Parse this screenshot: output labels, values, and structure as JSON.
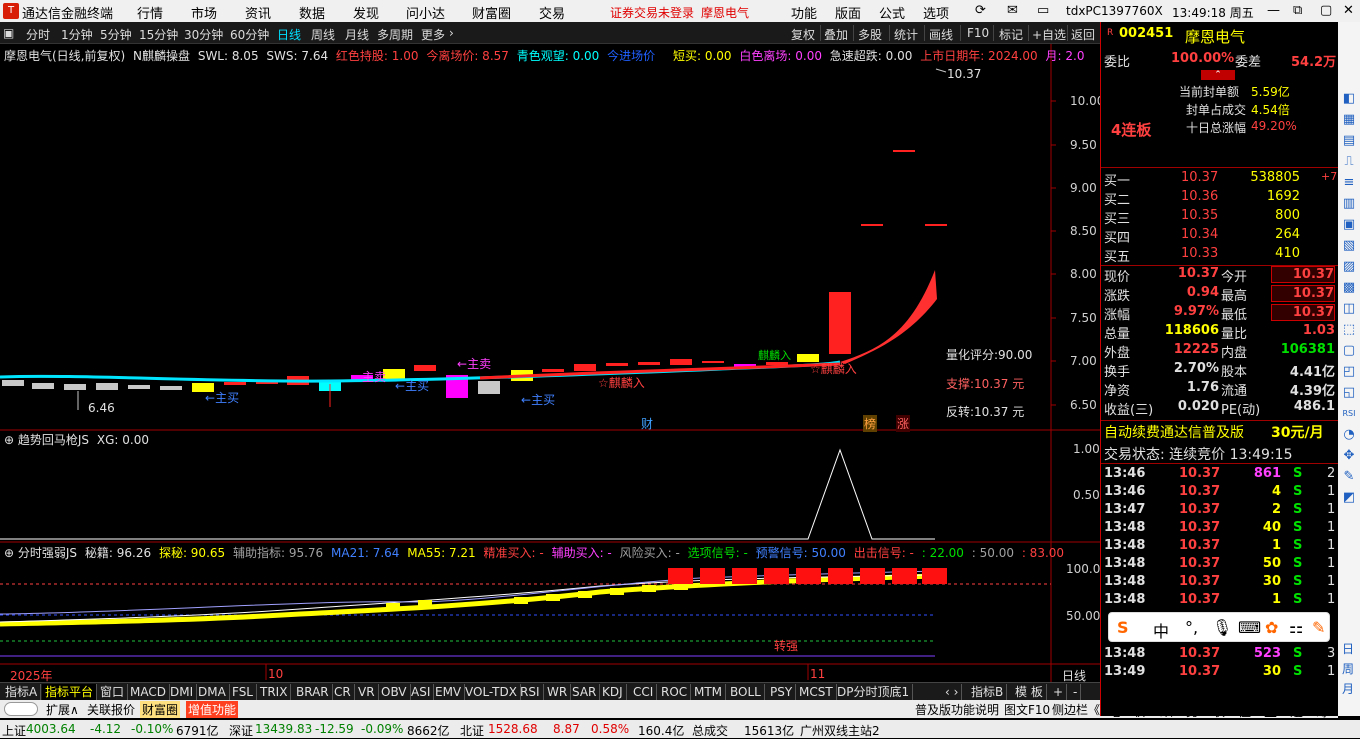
{
  "menubar": {
    "app_title": "通达信金融终端",
    "menus": [
      "行情",
      "市场",
      "资讯",
      "数据",
      "发现",
      "问小达",
      "财富圈",
      "交易"
    ],
    "notice": "证券交易未登录",
    "notice_stock": "摩恩电气",
    "right_menus": [
      "功能",
      "版面",
      "公式",
      "选项"
    ],
    "machine": "tdxPC1397760X",
    "time": "13:49:18 周五"
  },
  "toolbar": {
    "periods": [
      "分时",
      "1分钟",
      "5分钟",
      "15分钟",
      "30分钟",
      "60分钟",
      "日线",
      "周线",
      "月线",
      "多周期",
      "更多"
    ],
    "right": [
      "复权",
      "叠加",
      "多股",
      "统计",
      "画线",
      "F10",
      "标记",
      "+自选",
      "返回"
    ]
  },
  "main_header": {
    "title": "摩恩电气(日线,前复权)",
    "indicator": "N麒麟操盘",
    "swl": "SWL: 8.05",
    "sws": "SWS: 7.64",
    "red_hold": "红色持股: 1.00",
    "today_exit": "今离场价: 8.57",
    "cyan_watch": "青色观望: 0.00",
    "today_entry": "今进场价",
    "short_buy": "短买: 0.00",
    "white_exit": "白色离场: 0.00",
    "fast_drop": "急速超跌: 0.00",
    "list_days": "上市日期年: 2024.00",
    "month": "月: 2.0"
  },
  "main_chart": {
    "price_ticks": [
      "10.00",
      "9.50",
      "9.00",
      "8.50",
      "8.00",
      "7.50",
      "7.00",
      "6.50"
    ],
    "high_label": "10.37",
    "low_label": "6.46",
    "labels": {
      "main_buy_1": "主买",
      "main_buy_2": "主买",
      "main_buy_3": "主买",
      "main_sell_1": "主卖",
      "main_sell_2": "主卖",
      "qilin_1": "麒麟入",
      "qilin_2": "麒麟入",
      "qilin_3": "麒麟入",
      "fin": "财",
      "bang": "榜",
      "zhang": "涨"
    },
    "score": "量化评分:90.00",
    "support": "支撑:10.37 元",
    "reversal": "反转:10.37 元"
  },
  "sub1": {
    "title": "趋势回马枪JS",
    "xg": "XG: 0.00",
    "ticks": [
      "1.00",
      "0.50"
    ]
  },
  "sub2": {
    "title": "分时强弱JS",
    "mj": "秘籍: 96.26",
    "tm": "探秘: 90.65",
    "fz": "辅助指标: 95.76",
    "ma21": "MA21: 7.64",
    "ma55": "MA55: 7.21",
    "jz": "精准买入: -",
    "fzmr": "辅助买入: -",
    "fx": "风险买入: -",
    "xx": "选项信号: -",
    "yj": "预警信号: 50.00",
    "cj": "出击信号: -",
    "v22": ": 22.00",
    "v50": ": 50.00",
    "v83": ": 83.00",
    "ticks": [
      "100.0",
      "50.00"
    ],
    "turn": "转强"
  },
  "xaxis": {
    "year": "2025年",
    "m10": "10",
    "m11": "11",
    "right": "日线"
  },
  "tabs": [
    "指标A",
    "指标平台",
    "窗口",
    "MACD",
    "DMI",
    "DMA",
    "FSL",
    "TRIX",
    "BRAR",
    "CR",
    "VR",
    "OBV",
    "ASI",
    "EMV",
    "VOL-TDX",
    "RSI",
    "WR",
    "SAR",
    "KDJ",
    "CCI",
    "ROC",
    "MTM",
    "BOLL",
    "PSY",
    "MCST",
    "DP分时顶底1",
    "指标B",
    "模 板",
    "+",
    "-"
  ],
  "bottom": {
    "items": [
      "扩展∧",
      "关联报价",
      "财富圈",
      "增值功能"
    ],
    "right": "普及版功能说明",
    "f10": "图文F10",
    "side": "侧边栏《"
  },
  "rtabs": [
    "笔",
    "价",
    "细",
    "势",
    "联",
    "值",
    "主",
    "逆",
    "筹"
  ],
  "status": {
    "sh_label": "上证",
    "sh": "4003.64",
    "sh_chg": "-4.12",
    "sh_pct": "-0.10%",
    "sh_amt": "6791亿",
    "sz_label": "深证",
    "sz": "13439.83",
    "sz_chg": "-12.59",
    "sz_pct": "-0.09%",
    "sz_amt": "8662亿",
    "bz_label": "北证",
    "bz": "1528.68",
    "bz_chg": "8.87",
    "bz_pct": "0.58%",
    "bz_amt": "160.4亿",
    "total_label": "总成交",
    "total": "15613亿",
    "server": "广州双线主站2"
  },
  "stock": {
    "flag": "R",
    "code": "002451",
    "name": "摩恩电气",
    "webi_label": "委比",
    "webi": "100.00%",
    "wecha_label": "委差",
    "wecha": "54.2万",
    "fengdan_label": "当前封单额",
    "fengdan": "5.59亿",
    "fengcheng_label": "封单占成交",
    "fengcheng": "4.54倍",
    "tenday_label": "十日总涨幅",
    "tenday": "49.20%",
    "lianban": "4连板",
    "bids": [
      {
        "label": "买一",
        "price": "10.37",
        "vol": "538805",
        "extra": "+7"
      },
      {
        "label": "买二",
        "price": "10.36",
        "vol": "1692",
        "extra": ""
      },
      {
        "label": "买三",
        "price": "10.35",
        "vol": "800",
        "extra": ""
      },
      {
        "label": "买四",
        "price": "10.34",
        "vol": "264",
        "extra": ""
      },
      {
        "label": "买五",
        "price": "10.33",
        "vol": "410",
        "extra": ""
      }
    ],
    "quote": [
      {
        "l1": "现价",
        "v1": "10.37",
        "l2": "今开",
        "v2": "10.37"
      },
      {
        "l1": "涨跌",
        "v1": "0.94",
        "l2": "最高",
        "v2": "10.37"
      },
      {
        "l1": "涨幅",
        "v1": "9.97%",
        "l2": "最低",
        "v2": "10.37"
      },
      {
        "l1": "总量",
        "v1": "118606",
        "l2": "量比",
        "v2": "1.03"
      },
      {
        "l1": "外盘",
        "v1": "12225",
        "l2": "内盘",
        "v2": "106381"
      },
      {
        "l1": "换手",
        "v1": "2.70%",
        "l2": "股本",
        "v2": "4.41亿"
      },
      {
        "l1": "净资",
        "v1": "1.76",
        "l2": "流通",
        "v2": "4.39亿"
      },
      {
        "l1": "收益(三)",
        "v1": "0.020",
        "l2": "PE(动)",
        "v2": "486.1"
      }
    ],
    "ad": "自动续费通达信普及版",
    "ad_price": "30元/月",
    "trade_state": "交易状态: 连续竞价 13:49:15",
    "ticks": [
      {
        "t": "13:46",
        "p": "10.37",
        "v": "861",
        "s": "S",
        "n": "2"
      },
      {
        "t": "13:46",
        "p": "10.37",
        "v": "4",
        "s": "S",
        "n": "1"
      },
      {
        "t": "13:47",
        "p": "10.37",
        "v": "2",
        "s": "S",
        "n": "1"
      },
      {
        "t": "13:48",
        "p": "10.37",
        "v": "40",
        "s": "S",
        "n": "1"
      },
      {
        "t": "13:48",
        "p": "10.37",
        "v": "1",
        "s": "S",
        "n": "1"
      },
      {
        "t": "13:48",
        "p": "10.37",
        "v": "50",
        "s": "S",
        "n": "1"
      },
      {
        "t": "13:48",
        "p": "10.37",
        "v": "30",
        "s": "S",
        "n": "1"
      },
      {
        "t": "13:48",
        "p": "10.37",
        "v": "1",
        "s": "S",
        "n": "1"
      },
      {
        "t": "13:48",
        "p": "10.37",
        "v": "523",
        "s": "S",
        "n": "3"
      },
      {
        "t": "13:49",
        "p": "10.37",
        "v": "30",
        "s": "S",
        "n": "1"
      }
    ]
  },
  "ime": [
    "中",
    "°,"
  ]
}
